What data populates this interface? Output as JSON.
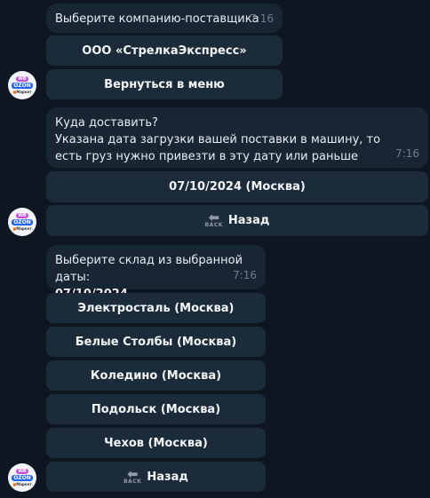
{
  "messages": [
    {
      "text": "Выберите компанию-поставщика",
      "time": "7:16",
      "buttons": [
        "ООО «СтрелкаЭкспресс»",
        "Вернуться в меню"
      ]
    },
    {
      "title": "Куда доставить?",
      "text": "Указана дата загрузки вашей поставки в машину, то есть груз нужно привезти в эту дату или раньше",
      "time": "7:16",
      "buttons": [
        "07/10/2024 (Москва)"
      ],
      "back_label": "Назад"
    },
    {
      "text": "Выберите склад из выбранной даты:",
      "date": "07/10/2024",
      "time": "7:16",
      "buttons": [
        "Электросталь (Москва)",
        "Белые Столбы (Москва)",
        "Коледино (Москва)",
        "Подольск (Москва)",
        "Чехов (Москва)"
      ],
      "back_label": "Назад"
    }
  ],
  "back_icon": {
    "icon": "back-arrow-icon",
    "text": "BACK"
  },
  "avatar": {
    "line1": "Wildberries",
    "line2": "OZON",
    "line3": "СМ Маркет"
  },
  "colors": {
    "background": "#0e1621",
    "bubble": "#182533",
    "button": "#1c2b3a",
    "time": "#6d7f8f"
  }
}
